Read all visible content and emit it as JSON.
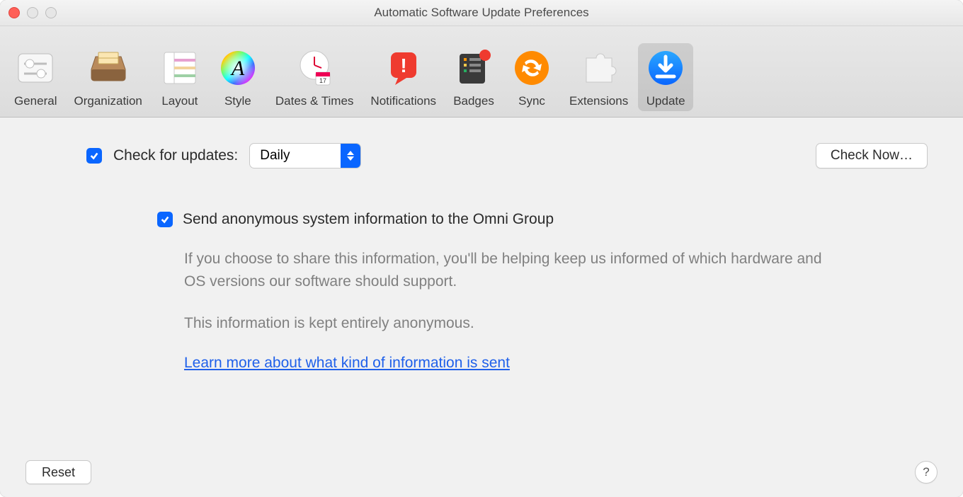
{
  "window": {
    "title": "Automatic Software Update Preferences"
  },
  "toolbar": {
    "items": [
      {
        "label": "General",
        "icon": "sliders"
      },
      {
        "label": "Organization",
        "icon": "drawer"
      },
      {
        "label": "Layout",
        "icon": "layout"
      },
      {
        "label": "Style",
        "icon": "style"
      },
      {
        "label": "Dates & Times",
        "icon": "calendar"
      },
      {
        "label": "Notifications",
        "icon": "notifications"
      },
      {
        "label": "Badges",
        "icon": "badges"
      },
      {
        "label": "Sync",
        "icon": "sync"
      },
      {
        "label": "Extensions",
        "icon": "extensions"
      },
      {
        "label": "Update",
        "icon": "update"
      }
    ],
    "selected_index": 9
  },
  "content": {
    "check_updates": {
      "checked": true,
      "label": "Check for updates:",
      "frequency": "Daily"
    },
    "check_now_label": "Check Now…",
    "send_info": {
      "checked": true,
      "label": "Send anonymous system information to the Omni Group",
      "description_p1": "If you choose to share this information, you'll be helping keep us informed of which hardware and OS versions our software should support.",
      "description_p2": "This information is kept entirely anonymous.",
      "learn_more": "Learn more about what kind of information is sent"
    }
  },
  "footer": {
    "reset_label": "Reset",
    "help_label": "?"
  },
  "colors": {
    "accent": "#0a66ff",
    "link": "#1f60ea"
  }
}
